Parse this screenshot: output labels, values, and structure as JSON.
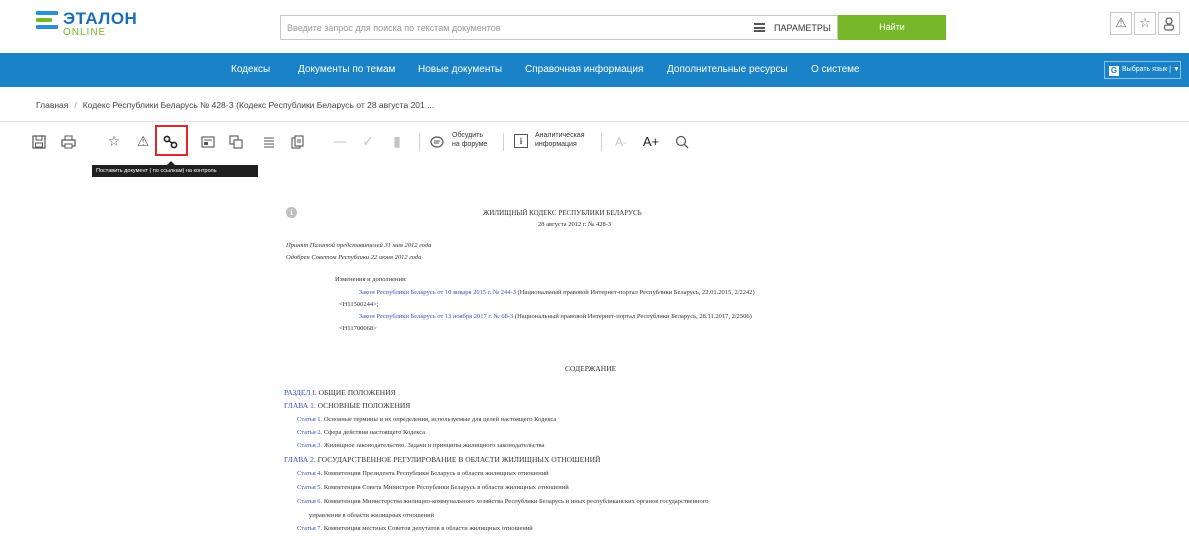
{
  "logo": {
    "title": "ЭТАЛОН",
    "subtitle": "ONLINE"
  },
  "search": {
    "placeholder": "Введите запрос для поиска по текстам документов",
    "params_label": "ПАРАМЕТРЫ",
    "find_label": "Найти"
  },
  "header_icons": [
    "warning-icon",
    "star-icon",
    "user-icon"
  ],
  "nav": {
    "items": [
      "Кодексы",
      "Документы по темам",
      "Новые документы",
      "Справочная информация",
      "Дополнительные ресурсы",
      "О системе"
    ],
    "lang_label": "Выбрать язык | ▼"
  },
  "breadcrumb": {
    "home": "Главная",
    "separator": "/",
    "current": "Кодекс Республики Беларусь № 428-З (Кодекс Республики Беларусь от 28 августа 201 ..."
  },
  "toolbar": {
    "forum_label_1": "Обсудить",
    "forum_label_2": "на форуме",
    "analytics_label_1": "Аналитическая",
    "analytics_label_2": "информация",
    "font_increase": "A+",
    "font_decrease": "A-",
    "tooltip": "Поставить документ ( по ссылкам) на контроль"
  },
  "document": {
    "title": "ЖИЛИЩНЫЙ КОДЕКС РЕСПУБЛИКИ БЕЛАРУСЬ",
    "date_line": "28 августа 2012 г. № 428-З",
    "adopted": "Принят Палатой представителей 31 мая 2012 года",
    "approved": "Одобрен Советом Республики 22 июня 2012 года",
    "changes_header": "Изменения и дополнения:",
    "change1_link": "Закон Республики Беларусь от 10 января 2015 г. № 244-З",
    "change1_text": "(Национальный правовой Интернет-портал Республики Беларусь, 22.01.2015, 2/2242)",
    "change1_code": "<H11500244>;",
    "change2_link": "Закон Республики Беларусь от 13 ноября 2017 г. № 68-З",
    "change2_text": "(Национальный правовой Интернет-портал Республики Беларусь, 28.11.2017, 2/2506)",
    "change2_code": "<H11700068>",
    "contents_title": "СОДЕРЖАНИЕ",
    "toc": [
      {
        "link": "РАЗДЕЛ I.",
        "text": "ОБЩИЕ ПОЛОЖЕНИЯ"
      },
      {
        "link": "ГЛАВА 1.",
        "text": "ОСНОВНЫЕ ПОЛОЖЕНИЯ"
      },
      {
        "link": "Статья 1.",
        "text": "Основные термины и их определения, используемые для целей настоящего Кодекса"
      },
      {
        "link": "Статья 2.",
        "text": "Сфера действия настоящего Кодекса"
      },
      {
        "link": "Статья 3.",
        "text": "Жилищное законодательство. Задачи и принципы жилищного законодательства"
      },
      {
        "link": "ГЛАВА 2.",
        "text": "ГОСУДАРСТВЕННОЕ РЕГУЛИРОВАНИЕ В ОБЛАСТИ ЖИЛИЩНЫХ ОТНОШЕНИЙ"
      },
      {
        "link": "Статья 4.",
        "text": "Компетенция Президента Республики Беларусь в области жилищных отношений"
      },
      {
        "link": "Статья 5.",
        "text": "Компетенция Совета Министров Республики Беларусь в области жилищных отношений"
      },
      {
        "link": "Статья 6.",
        "text": "Компетенция Министерства жилищно-коммунального хозяйства Республики Беларусь и иных республиканских органов государственного"
      },
      {
        "link": "",
        "text": "управления в области жилищных отношений"
      },
      {
        "link": "Статья 7.",
        "text": "Компетенция местных Советов депутатов в области жилищных отношений"
      }
    ]
  }
}
